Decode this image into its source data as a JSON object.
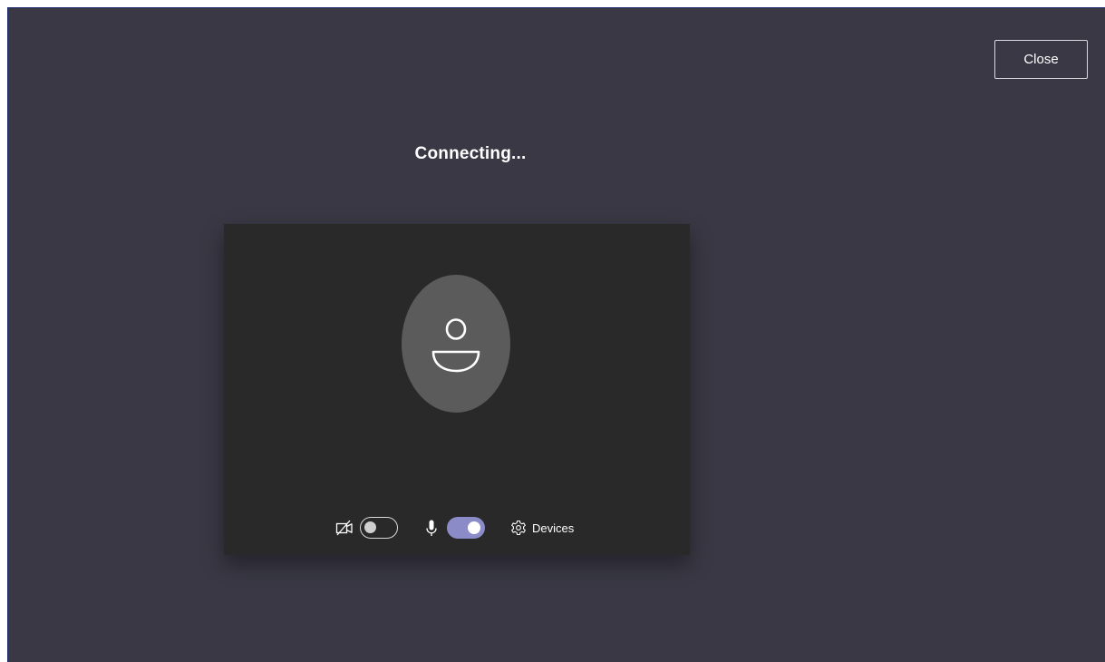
{
  "window": {
    "close_label": "Close",
    "status_text": "Connecting..."
  },
  "controls": {
    "camera_enabled": false,
    "mic_enabled": true,
    "devices_label": "Devices"
  },
  "icons": {
    "camera": "camera-off-icon",
    "microphone": "microphone-icon",
    "settings": "gear-icon",
    "avatar": "person-icon"
  },
  "colors": {
    "background": "#393844",
    "preview": "#292929",
    "avatar": "#5b5b5b",
    "toggle_on": "#8b8cc7"
  }
}
